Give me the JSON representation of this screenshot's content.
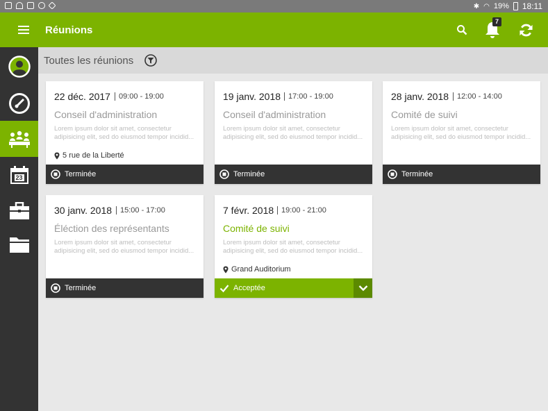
{
  "status_bar": {
    "battery": "19%",
    "time": "18:11"
  },
  "app_bar": {
    "title": "Réunions",
    "notification_count": "7"
  },
  "sidebar": {
    "items": [
      {
        "icon": "user-icon"
      },
      {
        "icon": "dashboard-icon"
      },
      {
        "icon": "meetings-icon",
        "active": true
      },
      {
        "icon": "calendar-icon",
        "day": "23"
      },
      {
        "icon": "briefcase-icon"
      },
      {
        "icon": "folder-icon"
      }
    ]
  },
  "header": {
    "title": "Toutes les réunions"
  },
  "meetings": [
    {
      "date": "22 déc. 2017",
      "time": "09:00 - 19:00",
      "name": "Conseil d'administration",
      "description": "Lorem ipsum dolor sit amet, consectetur adipisicing elit, sed do eiusmod tempor incidid...",
      "location": "5 rue de la Liberté",
      "status": "Terminée"
    },
    {
      "date": "19 janv. 2018",
      "time": "17:00 - 19:00",
      "name": "Conseil d'administration",
      "description": "Lorem ipsum dolor sit amet, consectetur adipisicing elit, sed do eiusmod tempor incidid...",
      "location": "",
      "status": "Terminée"
    },
    {
      "date": "28 janv. 2018",
      "time": "12:00 - 14:00",
      "name": "Comité de suivi",
      "description": "Lorem ipsum dolor sit amet, consectetur adipisicing elit, sed do eiusmod tempor incidid...",
      "location": "",
      "status": "Terminée"
    },
    {
      "date": "30 janv. 2018",
      "time": "15:00 - 17:00",
      "name": "Éléction des représentants",
      "description": "Lorem ipsum dolor sit amet, consectetur adipisicing elit, sed do eiusmod tempor incidid...",
      "location": "",
      "status": "Terminée"
    },
    {
      "date": "7 févr. 2018",
      "time": "19:00 - 21:00",
      "name": "Comité de suivi",
      "description": "Lorem ipsum dolor sit amet, consectetur adipisicing elit, sed do eiusmod tempor incidid...",
      "location": "Grand Auditorium",
      "status": "Acceptée"
    }
  ],
  "colors": {
    "accent": "#7cb300",
    "dark": "#333333"
  }
}
